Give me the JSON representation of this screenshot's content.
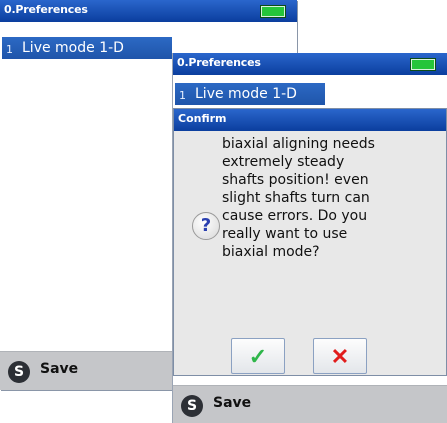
{
  "back_window": {
    "title": "0.Preferences",
    "list_item": "Live mode 1-D",
    "bottom": {
      "save_label": "Save",
      "save_button_glyph": "S"
    }
  },
  "front_window": {
    "title": "0.Preferences",
    "list_item": "Live mode 1-D",
    "bottom": {
      "save_label": "Save",
      "save_button_glyph": "S"
    }
  },
  "dialog": {
    "title": "Confirm",
    "icon": "question-icon",
    "icon_glyph": "?",
    "message": "biaxial aligning needs\nextremely steady\nshafts position! even\nslight shafts turn can\ncause errors. Do you\nreally want to use\nbiaxial mode?",
    "ok_glyph": "✓",
    "cancel_glyph": "✕"
  },
  "colors": {
    "titlebar": "#1a52b8",
    "selection": "#2563bb",
    "battery": "#25c53a",
    "ok": "#2fb64a",
    "cancel": "#e11c1c"
  }
}
